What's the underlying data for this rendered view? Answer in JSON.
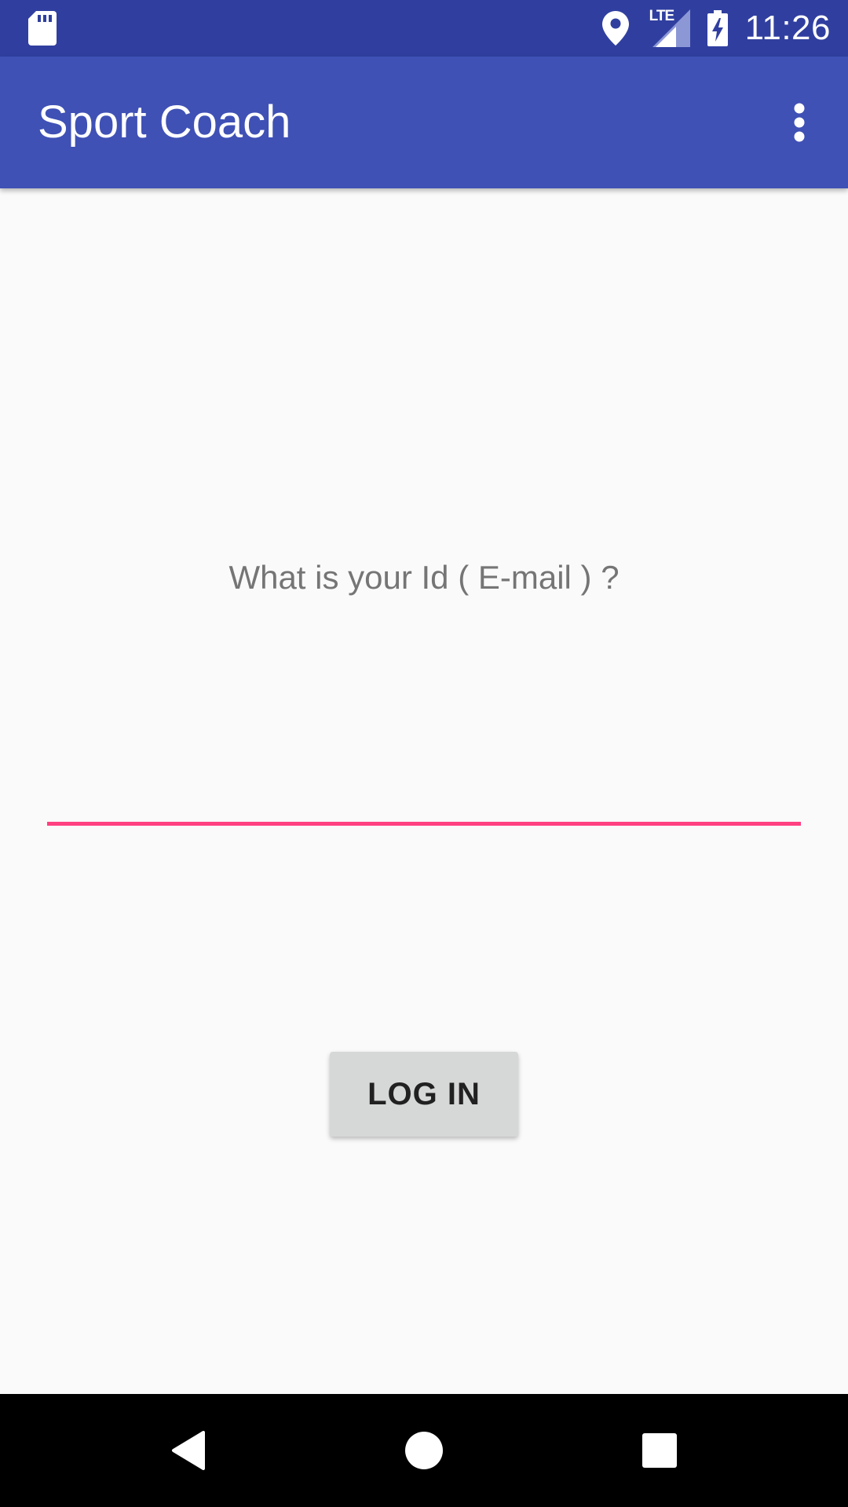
{
  "status_bar": {
    "time": "11:26",
    "network_label": "LTE",
    "icons": [
      "sd-card-icon",
      "location-icon",
      "lte-signal-icon",
      "battery-charging-icon"
    ]
  },
  "app_bar": {
    "title": "Sport Coach",
    "overflow_icon": "more-vertical-icon"
  },
  "login": {
    "prompt": "What is your Id ( E-mail ) ?",
    "email_value": "",
    "email_placeholder": "",
    "button_label": "LOG IN"
  },
  "navigation": {
    "icons": [
      "back-icon",
      "home-icon",
      "recents-icon"
    ]
  },
  "colors": {
    "status_bar": "#303f9f",
    "app_bar": "#3f51b5",
    "accent": "#ff4081",
    "background": "#fafafa",
    "button": "#d6d7d7"
  }
}
